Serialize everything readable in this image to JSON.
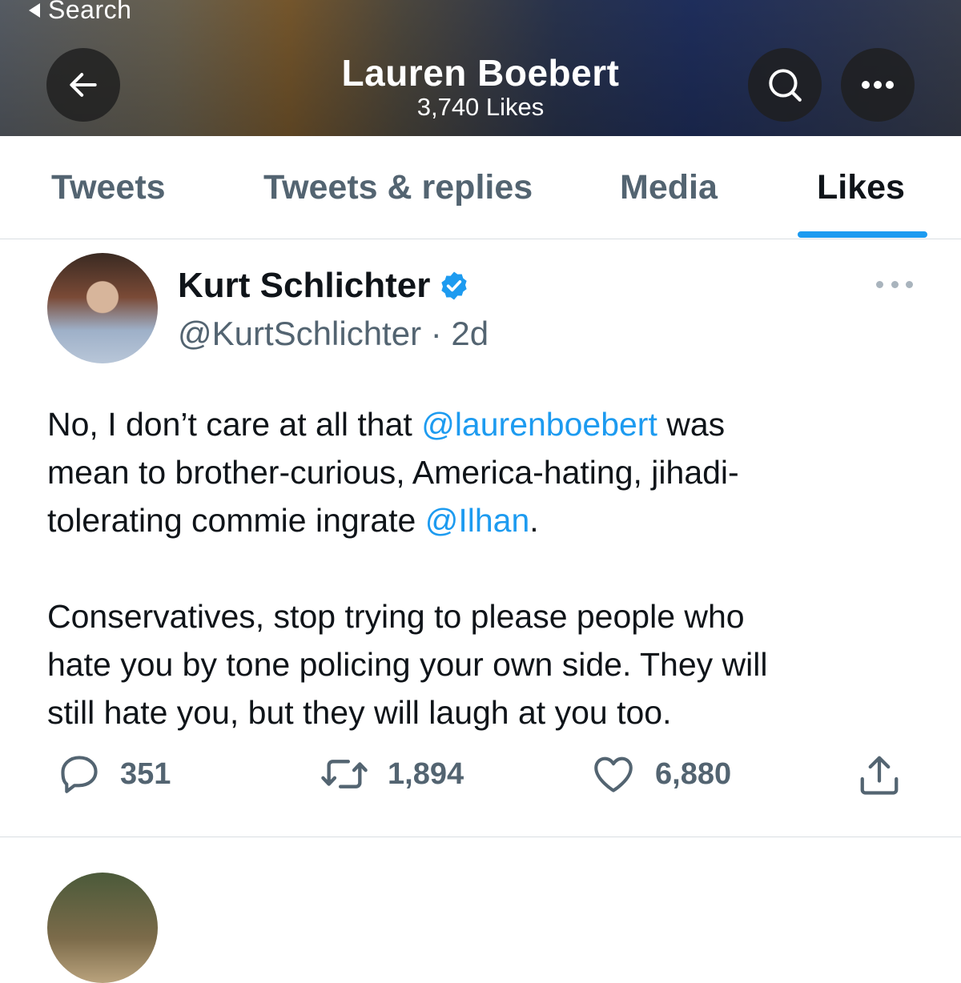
{
  "status_bar": {
    "back_label": "Search"
  },
  "header": {
    "title": "Lauren Boebert",
    "subtitle": "3,740 Likes"
  },
  "tabs": [
    {
      "label": "Tweets",
      "active": false
    },
    {
      "label": "Tweets & replies",
      "active": false
    },
    {
      "label": "Media",
      "active": false
    },
    {
      "label": "Likes",
      "active": true
    }
  ],
  "tweet": {
    "author_name": "Kurt Schlichter",
    "verified": true,
    "handle": "@KurtSchlichter",
    "separator": " · ",
    "time": "2d",
    "paragraph1": {
      "line1_a": "No, I don’t care at all that ",
      "mention1": "@laurenboebert",
      "line1_b": " was",
      "line2": "mean to brother-curious, America-hating, jihadi-",
      "line3_a": "tolerating commie ingrate ",
      "mention2": "@Ilhan",
      "line3_b": "."
    },
    "paragraph2": {
      "line1": "Conservatives, stop trying to please people who",
      "line2": "hate you by tone policing your own side. They will",
      "line3": "still hate you, but they will laugh at you too."
    },
    "actions": {
      "replies": "351",
      "retweets": "1,894",
      "likes": "6,880"
    }
  },
  "icons": {
    "back": "arrow-left-icon",
    "search": "search-icon",
    "more": "more-horizontal-icon",
    "verified": "verified-badge-icon",
    "reply": "reply-icon",
    "retweet": "retweet-icon",
    "like": "heart-icon",
    "share": "share-icon"
  },
  "colors": {
    "accent": "#1d9bf0",
    "secondary_text": "#536471",
    "primary_text": "#0f1419"
  }
}
